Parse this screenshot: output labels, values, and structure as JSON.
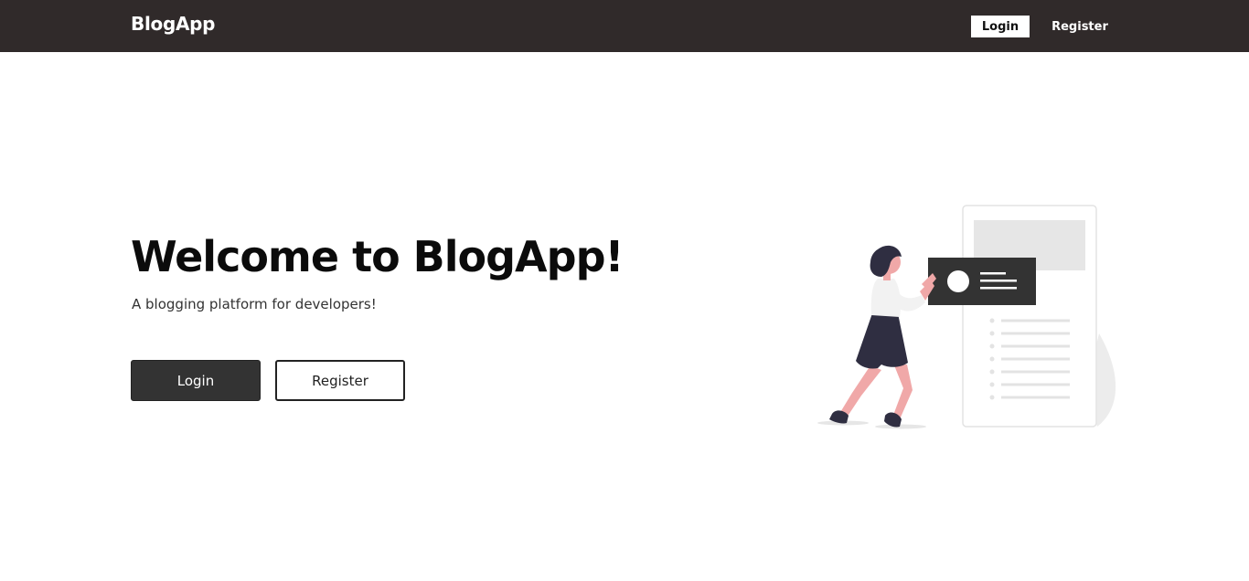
{
  "navbar": {
    "brand": "BlogApp",
    "login_label": "Login",
    "register_label": "Register"
  },
  "hero": {
    "title": "Welcome to BlogApp!",
    "subtitle": "A blogging platform for developers!",
    "login_label": "Login",
    "register_label": "Register",
    "illustration_icon": "woman-posting-blog-illustration"
  },
  "colors": {
    "navbar_bg": "#302a2a",
    "primary_button": "#333333",
    "accent_skin": "#f0a8a8",
    "dark_clothing": "#2f2e41"
  }
}
